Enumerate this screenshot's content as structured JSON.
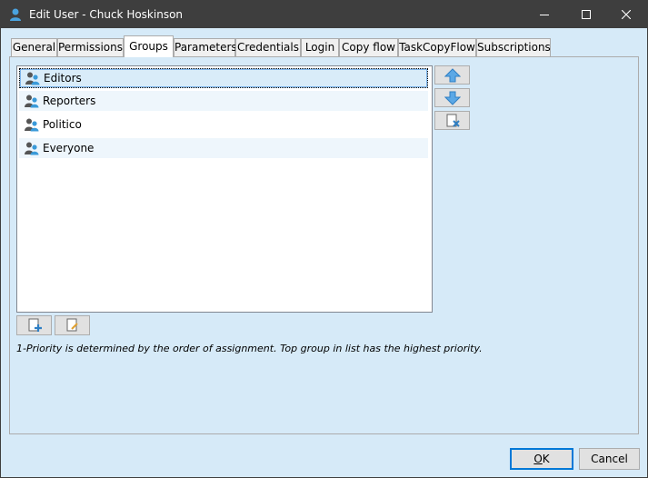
{
  "window": {
    "title": "Edit User - Chuck Hoskinson",
    "icon": "user-icon"
  },
  "tabs": [
    {
      "label": "General"
    },
    {
      "label": "Permissions"
    },
    {
      "label": "Groups",
      "active": true
    },
    {
      "label": "Parameters"
    },
    {
      "label": "Credentials"
    },
    {
      "label": "Login"
    },
    {
      "label": "Copy flow"
    },
    {
      "label": "TaskCopyFlow"
    },
    {
      "label": "Subscriptions"
    }
  ],
  "groups": {
    "items": [
      {
        "label": "Editors",
        "selected": true,
        "icon": "group-icon"
      },
      {
        "label": "Reporters",
        "icon": "group-icon"
      },
      {
        "label": "Politico",
        "icon": "group-icon"
      },
      {
        "label": "Everyone",
        "icon": "group-icon"
      }
    ],
    "side_buttons": [
      "move-up-icon",
      "move-down-icon",
      "remove-group-icon"
    ],
    "bottom_buttons": [
      "add-group-icon",
      "edit-group-icon"
    ],
    "note": "1-Priority is determined by the order of assignment. Top group in list has the highest priority."
  },
  "footer": {
    "ok_mnemonic": "O",
    "ok_rest": "K",
    "cancel_label": "Cancel"
  },
  "colors": {
    "titlebar": "#3e3e3e",
    "panel": "#d6eaf8",
    "accent": "#0078d7"
  }
}
